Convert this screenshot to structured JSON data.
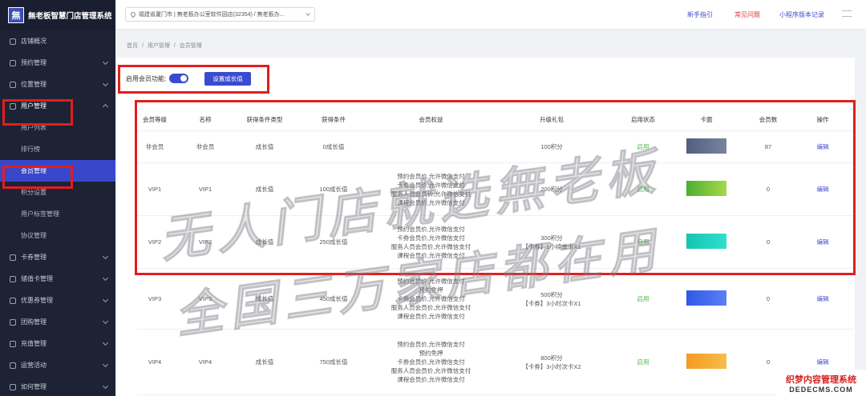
{
  "brand": {
    "logo_char": "無",
    "name": "無老板智慧门店管理系统"
  },
  "sidebar": {
    "items": [
      {
        "label": "店铺概况",
        "chevron": false
      },
      {
        "label": "预约管理",
        "chevron": true
      },
      {
        "label": "位置管理",
        "chevron": true
      },
      {
        "label": "用户管理",
        "chevron": true,
        "open": true
      },
      {
        "label": "卡券管理",
        "chevron": true
      },
      {
        "label": "储值卡管理",
        "chevron": true
      },
      {
        "label": "优惠券管理",
        "chevron": true
      },
      {
        "label": "团购管理",
        "chevron": true
      },
      {
        "label": "充值管理",
        "chevron": true
      },
      {
        "label": "运营活动",
        "chevron": true
      },
      {
        "label": "如何管理",
        "chevron": true
      }
    ],
    "sub_items": [
      "用户列表",
      "排行榜",
      "会员管理",
      "积分设置",
      "用户标签管理",
      "协议管理"
    ]
  },
  "topbar": {
    "store_select": "福建省厦门市 | 無老板办公室软件园店(32354) / 無老板办...",
    "links": [
      "新手指引",
      "常见问题",
      "小程序版本记录"
    ]
  },
  "breadcrumb": [
    "首页",
    "/",
    "用户管理",
    "/",
    "会员管理"
  ],
  "member_toggle_label": "启用会员功能:",
  "growth_button": "设置成长值",
  "table": {
    "headers": [
      "会员等级",
      "名称",
      "获得条件类型",
      "获得条件",
      "会员权益",
      "升级礼包",
      "启用状态",
      "卡面",
      "会员数",
      "操作"
    ],
    "rows": [
      {
        "level": "非会员",
        "name": "非会员",
        "cond_type": "成长值",
        "cond": "0成长值",
        "benefits": [],
        "gift": [
          "100积分"
        ],
        "status": "启用",
        "card_color": "#525e80",
        "card_color2": "#7a84a0",
        "count": "87",
        "action": "编辑"
      },
      {
        "level": "VIP1",
        "name": "VIP1",
        "cond_type": "成长值",
        "cond": "100成长值",
        "benefits": [
          "预约会员价,允许微信支付",
          "卡券会员价,允许微信支付",
          "服务人员会员价,允许微信支付",
          "课程会员价,允许微信支付"
        ],
        "gift": [
          "200积分"
        ],
        "status": "启用",
        "card_color": "#4caf32",
        "card_color2": "#a6d94a",
        "count": "0",
        "action": "编辑"
      },
      {
        "level": "VIP2",
        "name": "VIP2",
        "cond_type": "成长值",
        "cond": "250成长值",
        "benefits": [
          "预约会员价,允许微信支付",
          "卡券会员价,允许微信支付",
          "服务人员会员价,允许微信支付",
          "课程会员价,允许微信支付"
        ],
        "gift": [
          "300积分",
          "【卡券】1小续单卡X1"
        ],
        "status": "启用",
        "card_color": "#16c3b0",
        "card_color2": "#2fe0cf",
        "count": "0",
        "action": "编辑"
      },
      {
        "level": "VIP3",
        "name": "VIP3",
        "cond_type": "成长值",
        "cond": "450成长值",
        "benefits": [
          "预约会员价,允许微信支付",
          "预约免押",
          "卡券会员价,允许微信支付",
          "服务人员会员价,允许微信支付",
          "课程会员价,允许微信支付"
        ],
        "gift": [
          "500积分",
          "【卡券】3小时次卡X1"
        ],
        "status": "启用",
        "card_color": "#2f58e6",
        "card_color2": "#5b7ff5",
        "count": "0",
        "action": "编辑"
      },
      {
        "level": "VIP4",
        "name": "VIP4",
        "cond_type": "成长值",
        "cond": "750成长值",
        "benefits": [
          "预约会员价,允许微信支付",
          "预约免押",
          "卡券会员价,允许微信支付",
          "服务人员会员价,允许微信支付",
          "课程会员价,允许微信支付"
        ],
        "gift": [
          "800积分",
          "【卡券】3小时次卡X2"
        ],
        "status": "启用",
        "card_color": "#f59a23",
        "card_color2": "#f7bd4a",
        "count": "0",
        "action": "编辑"
      }
    ]
  },
  "watermark": {
    "line1": "无人门店就选無老板",
    "line2": "全国三万家店都在用"
  },
  "corner_badge": {
    "line1": "织梦内容管理系统",
    "line2": "DEDECMS.COM"
  },
  "colors": {
    "accent": "#3b4bd0",
    "highlight_box": "#e21d1d",
    "sidebar_bg": "#1d2234"
  }
}
